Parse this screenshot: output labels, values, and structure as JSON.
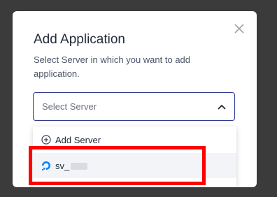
{
  "modal": {
    "title": "Add Application",
    "subtitle": "Select Server in which you want to add application.",
    "close_icon": "close-icon"
  },
  "select": {
    "placeholder": "Select Server",
    "chevron_icon": "chevron-up-icon"
  },
  "dropdown": {
    "add_server_label": "Add Server",
    "add_icon": "plus-circle-icon",
    "servers": [
      {
        "name": "sv_",
        "icon": "digitalocean-icon",
        "icon_color": "#0080ff"
      }
    ]
  },
  "colors": {
    "backdrop": "#3b3b3b",
    "select_border": "#2f3a8f",
    "highlight": "#ff0000",
    "server_row_bg": "#f3f4f8"
  }
}
